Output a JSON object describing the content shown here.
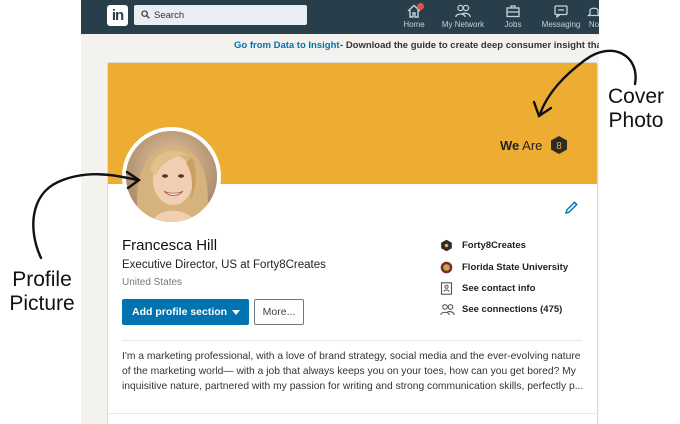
{
  "nav": {
    "logo_text": "in",
    "search_placeholder": "Search",
    "items": [
      {
        "label": "Home",
        "icon": "home-icon"
      },
      {
        "label": "My Network",
        "icon": "network-icon"
      },
      {
        "label": "Jobs",
        "icon": "briefcase-icon"
      },
      {
        "label": "Messaging",
        "icon": "messaging-icon"
      },
      {
        "label": "No",
        "icon": "notifications-icon"
      }
    ],
    "colors": {
      "bar": "#283e4a",
      "notification": "#e0533e"
    }
  },
  "ad": {
    "link_text": "Go from Data to Insight",
    "separator": " - ",
    "body_text": "Download the guide to create deep consumer insight that c"
  },
  "profile": {
    "cover": {
      "color": "#edac32",
      "brand_bold": "We",
      "brand_light": " Are",
      "brand_badge": "8"
    },
    "name": "Francesca Hill",
    "headline": "Executive Director, US at Forty8Creates",
    "location": "United States",
    "buttons": {
      "add_section": "Add profile section",
      "more": "More..."
    },
    "side_items": [
      {
        "label": "Forty8Creates",
        "icon": "company-logo-icon"
      },
      {
        "label": "Florida State University",
        "icon": "university-logo-icon"
      },
      {
        "label": "See contact info",
        "icon": "contact-card-icon"
      },
      {
        "label": "See connections (475)",
        "icon": "connections-icon"
      }
    ],
    "about": [
      "I'm a marketing professional, with a love of brand strategy, social media and the ever-evolving nature",
      "of the marketing world— with a job that always keeps you on your toes, how can you get bored? My",
      "inquisitive nature, partnered with my passion for writing and strong communication skills, perfectly p..."
    ],
    "accent": "#0073b1"
  },
  "annotations": {
    "cover_line1": "Cover",
    "cover_line2": "Photo",
    "profile_line1": "Profile",
    "profile_line2": "Picture"
  }
}
